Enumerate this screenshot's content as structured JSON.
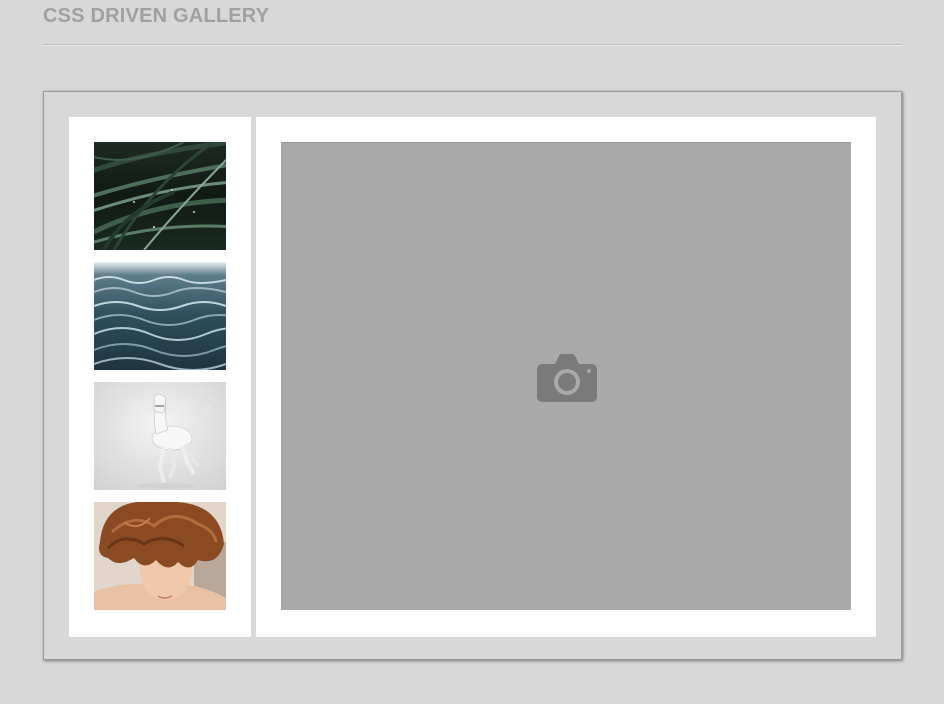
{
  "header": {
    "title": "CSS DRIVEN GALLERY"
  },
  "gallery": {
    "thumbnails": [
      {
        "name": "grass-thumbnail",
        "subject": "wet green grass blades"
      },
      {
        "name": "water-thumbnail",
        "subject": "dark ocean waves"
      },
      {
        "name": "horse-thumbnail",
        "subject": "white horse galloping"
      },
      {
        "name": "portrait-thumbnail",
        "subject": "child with curly auburn hair"
      }
    ],
    "viewer": {
      "placeholder_icon": "camera-icon"
    }
  },
  "colors": {
    "page_background": "#d8d8d8",
    "title_text": "#a0a0a0",
    "panel_background": "#ffffff",
    "viewer_placeholder": "#a9a9a9",
    "camera_icon": "#7a7a7a"
  }
}
